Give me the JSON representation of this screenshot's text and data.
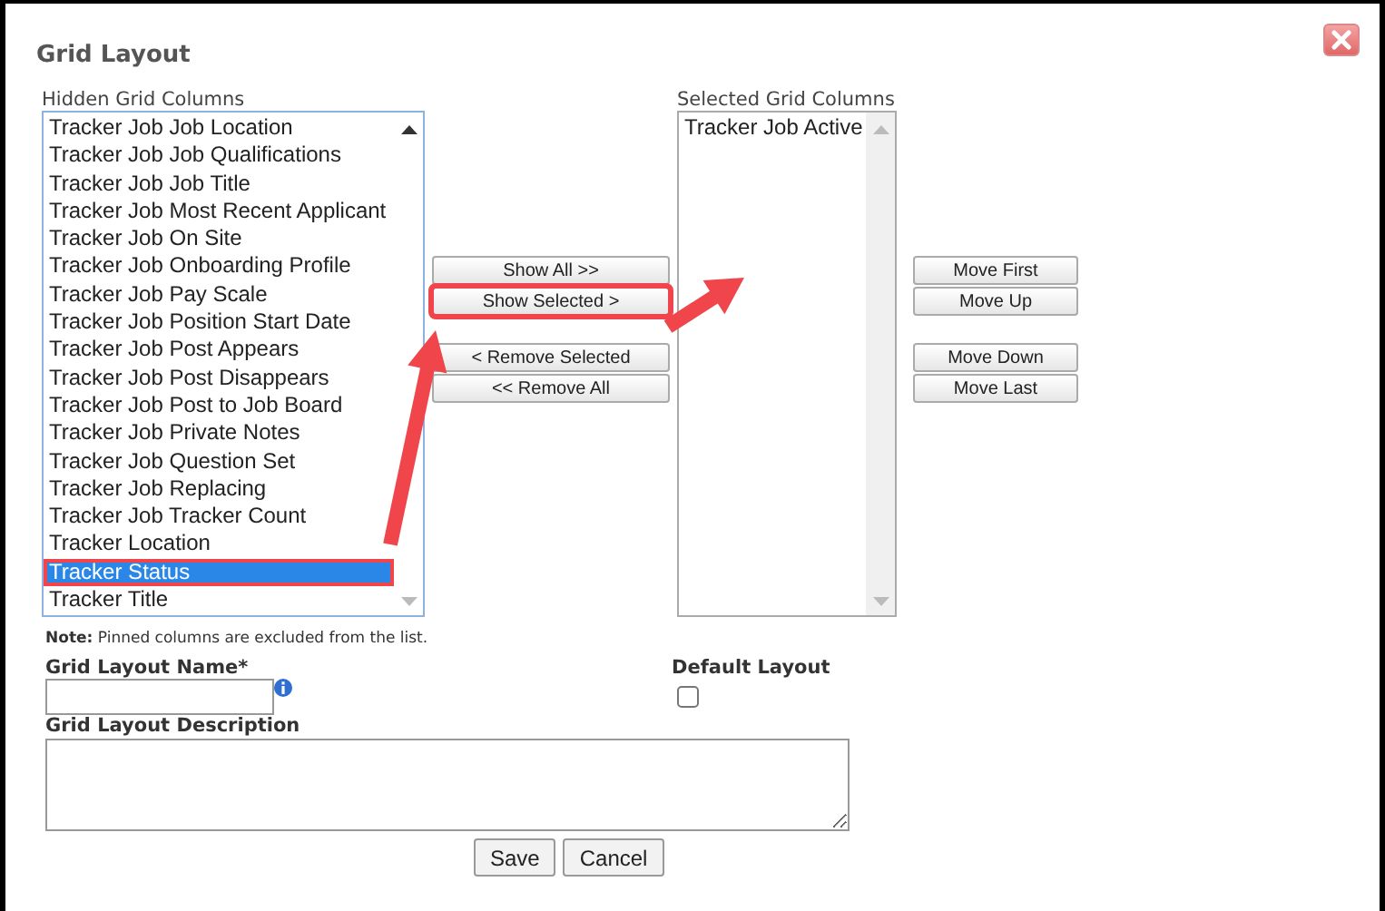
{
  "dialog": {
    "title": "Grid Layout"
  },
  "hidden_columns": {
    "label": "Hidden Grid Columns",
    "items": [
      {
        "label": "Tracker Job Job Location",
        "selected": false,
        "highlighted": false
      },
      {
        "label": "Tracker Job Job Qualifications",
        "selected": false,
        "highlighted": false
      },
      {
        "label": "Tracker Job Job Title",
        "selected": false,
        "highlighted": false
      },
      {
        "label": "Tracker Job Most Recent Applicant",
        "selected": false,
        "highlighted": false
      },
      {
        "label": "Tracker Job On Site",
        "selected": false,
        "highlighted": false
      },
      {
        "label": "Tracker Job Onboarding Profile",
        "selected": false,
        "highlighted": false
      },
      {
        "label": "Tracker Job Pay Scale",
        "selected": false,
        "highlighted": false
      },
      {
        "label": "Tracker Job Position Start Date",
        "selected": false,
        "highlighted": false
      },
      {
        "label": "Tracker Job Post Appears",
        "selected": false,
        "highlighted": false
      },
      {
        "label": "Tracker Job Post Disappears",
        "selected": false,
        "highlighted": false
      },
      {
        "label": "Tracker Job Post to Job Board",
        "selected": false,
        "highlighted": false
      },
      {
        "label": "Tracker Job Private Notes",
        "selected": false,
        "highlighted": false
      },
      {
        "label": "Tracker Job Question Set",
        "selected": false,
        "highlighted": false
      },
      {
        "label": "Tracker Job Replacing",
        "selected": false,
        "highlighted": false
      },
      {
        "label": "Tracker Job Tracker Count",
        "selected": false,
        "highlighted": false
      },
      {
        "label": "Tracker Location",
        "selected": false,
        "highlighted": false
      },
      {
        "label": "Tracker Status",
        "selected": true,
        "highlighted": true
      },
      {
        "label": "Tracker Title",
        "selected": false,
        "highlighted": false
      }
    ]
  },
  "transfer_buttons": [
    [
      {
        "label": "Show All >>",
        "highlighted": false
      },
      {
        "label": "Show Selected >",
        "highlighted": true
      }
    ],
    [
      {
        "label": "< Remove Selected",
        "highlighted": false
      },
      {
        "label": "<< Remove All",
        "highlighted": false
      }
    ]
  ],
  "selected_columns": {
    "label": "Selected Grid Columns",
    "items": [
      {
        "label": "Tracker Job Active",
        "selected": false,
        "highlighted": false
      }
    ]
  },
  "order_buttons": [
    [
      {
        "label": "Move First",
        "highlighted": false
      },
      {
        "label": "Move Up",
        "highlighted": false
      }
    ],
    [
      {
        "label": "Move Down",
        "highlighted": false
      },
      {
        "label": "Move Last",
        "highlighted": false
      }
    ]
  ],
  "note": "**Note:** Pinned columns are excluded from the list.",
  "name_field": {
    "label": "Grid Layout Name*"
  },
  "default_layout": {
    "label": "Default Layout",
    "checked": false
  },
  "description_field": {
    "label": "Grid Layout Description"
  },
  "buttons": [
    "Save",
    "Cancel"
  ]
}
